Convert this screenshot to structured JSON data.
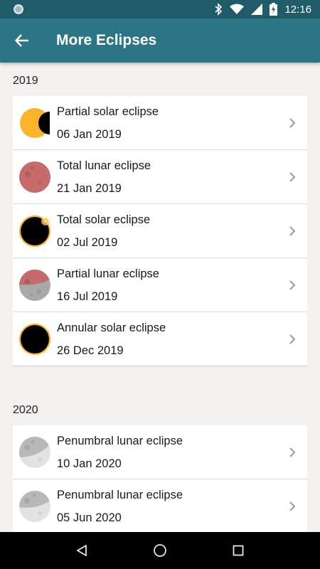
{
  "status_bar": {
    "time": "12:16"
  },
  "app_bar": {
    "title": "More Eclipses"
  },
  "sections": [
    {
      "year": "2019",
      "items": [
        {
          "title": "Partial solar eclipse",
          "date": "06 Jan 2019",
          "icon": "partial-solar-eclipse-icon"
        },
        {
          "title": "Total lunar eclipse",
          "date": "21 Jan 2019",
          "icon": "total-lunar-eclipse-icon"
        },
        {
          "title": "Total solar eclipse",
          "date": "02 Jul 2019",
          "icon": "total-solar-eclipse-icon"
        },
        {
          "title": "Partial lunar eclipse",
          "date": "16 Jul 2019",
          "icon": "partial-lunar-eclipse-icon"
        },
        {
          "title": "Annular solar eclipse",
          "date": "26 Dec 2019",
          "icon": "annular-solar-eclipse-icon"
        }
      ]
    },
    {
      "year": "2020",
      "items": [
        {
          "title": "Penumbral lunar eclipse",
          "date": "10 Jan 2020",
          "icon": "penumbral-lunar-eclipse-icon"
        },
        {
          "title": "Penumbral lunar eclipse",
          "date": "05 Jun 2020",
          "icon": "penumbral-lunar-eclipse-icon"
        }
      ]
    }
  ],
  "colors": {
    "status_bar": "#1f5b68",
    "app_bar": "#2b7584",
    "sun": "#fbb42c",
    "blood_moon": "#c56b6b",
    "grey_moon": "#b4b4b4",
    "background": "#f3f0ef"
  }
}
